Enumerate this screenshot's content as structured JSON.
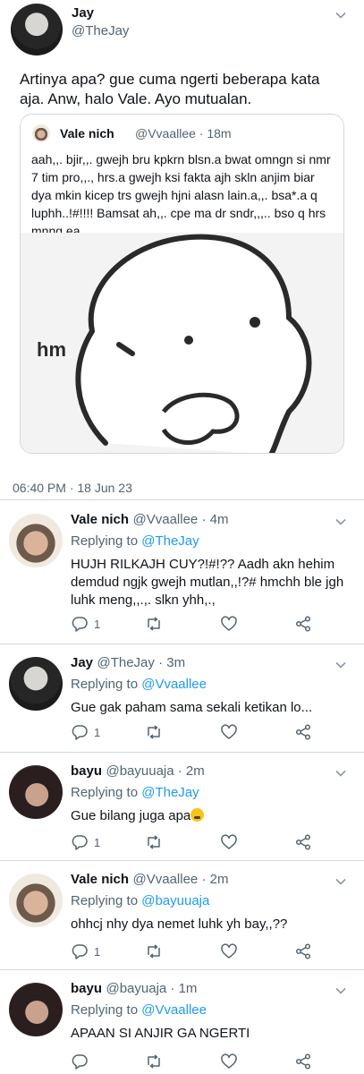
{
  "main_tweet": {
    "author_name": "Jay",
    "author_handle": "@TheJay",
    "text": "Artinya apa? gue cuma ngerti beberapa kata aja. Anw, halo Vale. Ayo mutualan.",
    "timestamp": "06:40 PM · 18 Jun 23",
    "avatar_icon": "avatar-dark",
    "quote": {
      "author_name": "Vale nich",
      "meta": "@Vvaallee · 18m",
      "text": "aah,,. bjir,,. gwejh bru kpkrn blsn.a bwat omngn si nmr 7 tim pro,,., hrs.a gwejh ksi fakta ajh skln anjim biar dya mkin kicep trs gwejh hjni alasn lain.a,,. bsa*.a q luphh..!#!!!! Bamsat ah,,. cpe ma dr sndr,,,.. bso q hrs mnng ea..,..",
      "image_caption": "hm"
    }
  },
  "replies": [
    {
      "author_name": "Vale nich",
      "meta": "@Vvaallee · 4m",
      "replying_prefix": "Replying to",
      "replying_to": "@TheJay",
      "text": "HUJH RILKAJH CUY?!#!?? Aadh akn hehim demdud ngjk gwejh mutlan,,!?# hmchh ble jgh luhk meng,,.,. slkn yhh,.,",
      "reply_count": "1"
    },
    {
      "author_name": "Jay",
      "meta": "@TheJay · 3m",
      "replying_prefix": "Replying to",
      "replying_to": "@Vvaallee",
      "text": "Gue gak paham sama sekali ketikan lo...",
      "reply_count": "1"
    },
    {
      "author_name": "bayu",
      "meta": "@bayuuaja · 2m",
      "replying_prefix": "Replying to",
      "replying_to": "@TheJay",
      "text": "Gue bilang juga apa",
      "reply_count": "1"
    },
    {
      "author_name": "Vale nich",
      "meta": "@Vvaallee · 2m",
      "replying_prefix": "Replying to",
      "replying_to": "@bayuuaja",
      "text": "ohhcj nhy dya nemet luhk yh bay,,??",
      "reply_count": "1"
    },
    {
      "author_name": "bayu",
      "meta": "@bayuaja · 1m",
      "replying_prefix": "Replying to",
      "replying_to": "@Vvaallee",
      "text": "APAAN SI ANJIR GA NGERTI",
      "reply_count": ""
    }
  ],
  "icons": {
    "reply": "comment-icon",
    "retweet": "retweet-icon",
    "like": "heart-icon",
    "share": "share-icon",
    "more": "chevron-down-icon"
  },
  "colors": {
    "link": "#1d9bf0",
    "secondary_text": "#536471",
    "divider": "#cfd9de"
  }
}
